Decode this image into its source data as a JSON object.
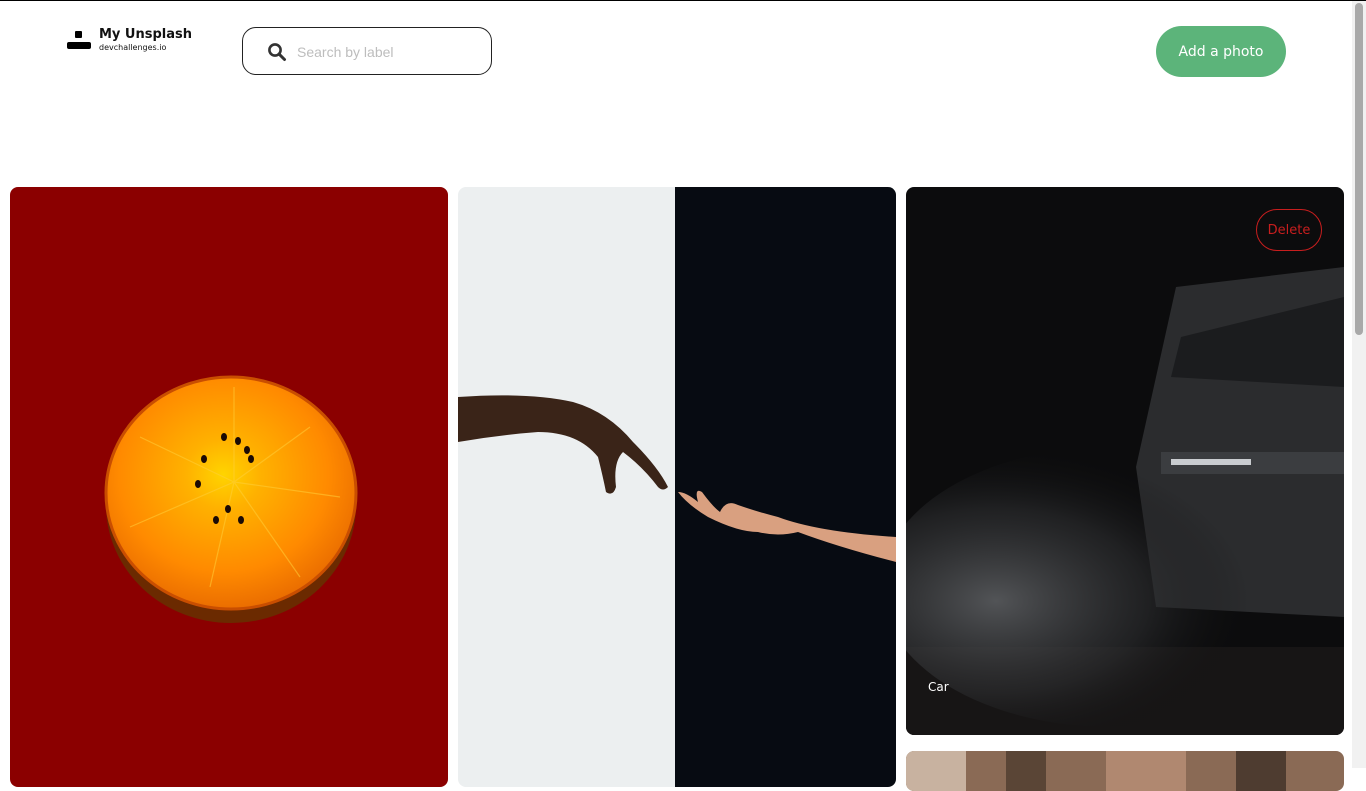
{
  "header": {
    "logo_title": "My Unsplash",
    "logo_subtitle": "devchallenges.io",
    "search_placeholder": "Search by label",
    "search_value": "",
    "add_button_label": "Add a photo"
  },
  "gallery": {
    "photos": [
      {
        "label": "",
        "subject": "orange fruit slice on red background"
      },
      {
        "label": "",
        "subject": "two hands reaching on white and black background"
      },
      {
        "label": "Car",
        "subject": "dark SUV driving through dust",
        "delete_label": "Delete"
      },
      {
        "label": "",
        "subject": "autumn trees (partially visible)"
      }
    ]
  },
  "colors": {
    "accent": "#5cb47a",
    "delete": "#c81e1e",
    "orange_bg": "#8b0000"
  }
}
